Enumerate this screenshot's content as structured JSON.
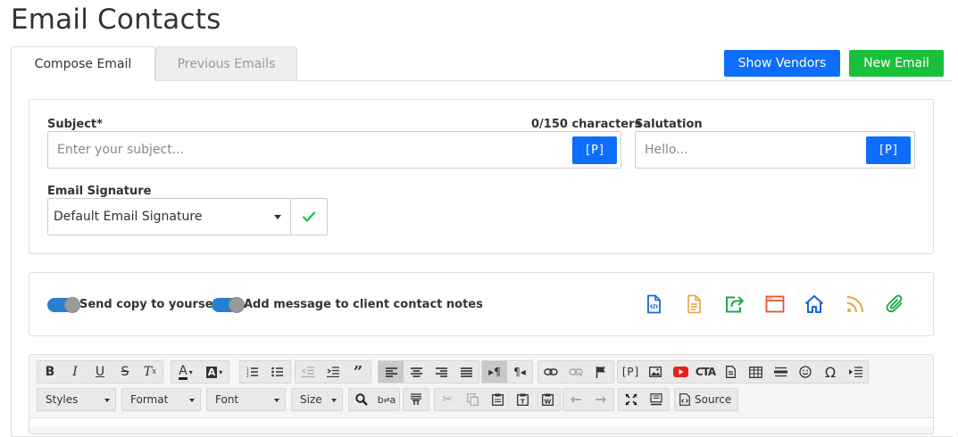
{
  "page": {
    "title": "Email Contacts"
  },
  "tabs": [
    {
      "label": "Compose Email",
      "active": true
    },
    {
      "label": "Previous Emails",
      "active": false
    }
  ],
  "header_buttons": {
    "show_vendors": "Show Vendors",
    "new_email": "New Email"
  },
  "colors": {
    "primary": "#0d6efd",
    "success": "#19c13a",
    "toggle": "#2a7fd1"
  },
  "form": {
    "subject": {
      "label": "Subject*",
      "counter": "0/150 characters",
      "placeholder": "Enter your subject...",
      "value": "",
      "placeholder_button": "[P]"
    },
    "salutation": {
      "label": "Salutation",
      "placeholder": "Hello...",
      "value": "",
      "placeholder_button": "[P]"
    },
    "signature": {
      "label": "Email Signature",
      "selected": "Default Email Signature"
    }
  },
  "options": {
    "send_copy": {
      "label": "Send copy to yourself",
      "on": true
    },
    "add_note": {
      "label": "Add message to client contact notes",
      "on": true
    },
    "action_icons": [
      "code-file-icon",
      "document-icon",
      "share-icon",
      "browser-window-icon",
      "home-icon",
      "rss-icon",
      "paperclip-icon"
    ]
  },
  "editor": {
    "toolbar_row1": [
      "bold",
      "italic",
      "underline",
      "strikethrough",
      "remove-format",
      "text-color",
      "background-color",
      "numbered-list",
      "bulleted-list",
      "outdent",
      "indent",
      "blockquote",
      "align-left",
      "align-center",
      "align-right",
      "justify",
      "ltr",
      "rtl",
      "link",
      "unlink",
      "anchor",
      "placeholder",
      "image",
      "youtube",
      "cta",
      "template",
      "table",
      "horizontal-rule",
      "smiley",
      "special-char",
      "page-break"
    ],
    "combos": {
      "styles": "Styles",
      "format": "Format",
      "font": "Font",
      "size": "Size"
    },
    "source_label": "Source"
  }
}
